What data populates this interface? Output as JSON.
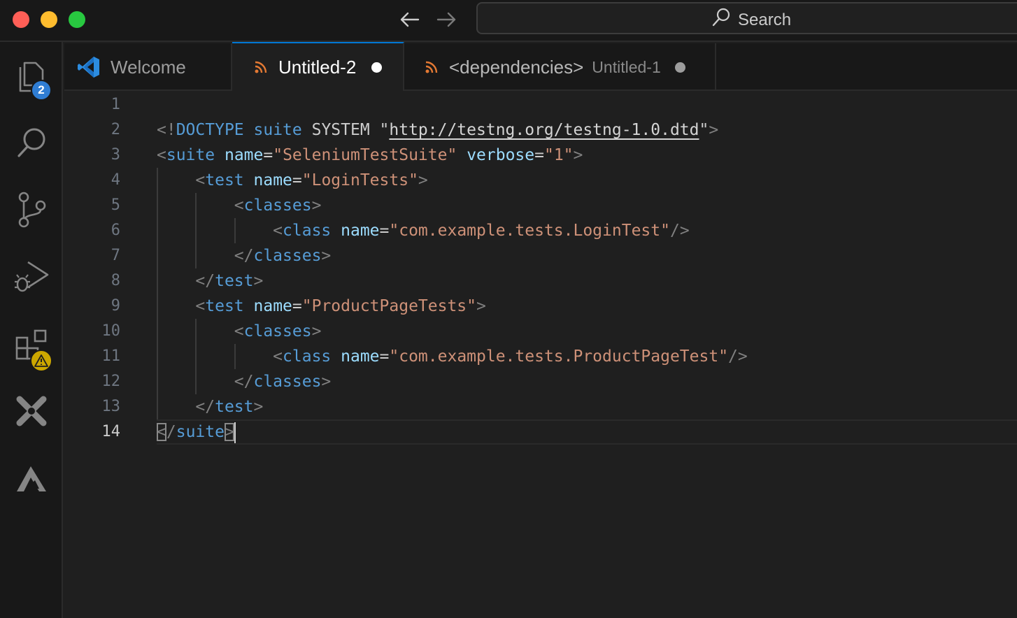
{
  "window": {
    "search_label": "Search"
  },
  "activity_bar": {
    "items": [
      {
        "name": "explorer",
        "icon": "files-icon",
        "badge": "2"
      },
      {
        "name": "search",
        "icon": "search-icon"
      },
      {
        "name": "source-control",
        "icon": "source-control-icon"
      },
      {
        "name": "run-debug",
        "icon": "run-debug-icon"
      },
      {
        "name": "extensions",
        "icon": "extensions-icon",
        "badge": "⚠"
      },
      {
        "name": "extension-x",
        "icon": "x-tool-icon"
      },
      {
        "name": "extension-a",
        "icon": "a-tool-icon"
      }
    ]
  },
  "tabs": [
    {
      "label": "Welcome",
      "icon": "vscode-logo-icon",
      "active": false
    },
    {
      "label": "Untitled-2",
      "icon": "rss-icon",
      "active": true,
      "dirty": true
    },
    {
      "label": "<dependencies>",
      "sublabel": "Untitled-1",
      "icon": "rss-icon",
      "active": false,
      "dirty": true
    }
  ],
  "editor": {
    "current_line": 14,
    "line_numbers": [
      "1",
      "2",
      "3",
      "4",
      "5",
      "6",
      "7",
      "8",
      "9",
      "10",
      "11",
      "12",
      "13",
      "14"
    ],
    "lines": [
      [],
      [
        [
          "br",
          "<!"
        ],
        [
          "tag",
          "DOCTYPE"
        ],
        [
          "plain",
          " "
        ],
        [
          "tag",
          "suite"
        ],
        [
          "plain",
          " SYSTEM \""
        ],
        [
          "link",
          "http://testng.org/testng-1.0.dtd"
        ],
        [
          "plain",
          "\""
        ],
        [
          "br",
          ">"
        ]
      ],
      [
        [
          "br",
          "<"
        ],
        [
          "tag",
          "suite"
        ],
        [
          "plain",
          " "
        ],
        [
          "attr",
          "name"
        ],
        [
          "plain",
          "="
        ],
        [
          "str",
          "\"SeleniumTestSuite\""
        ],
        [
          "plain",
          " "
        ],
        [
          "attr",
          "verbose"
        ],
        [
          "plain",
          "="
        ],
        [
          "str",
          "\"1\""
        ],
        [
          "br",
          ">"
        ]
      ],
      [
        [
          "plain",
          "    "
        ],
        [
          "br",
          "<"
        ],
        [
          "tag",
          "test"
        ],
        [
          "plain",
          " "
        ],
        [
          "attr",
          "name"
        ],
        [
          "plain",
          "="
        ],
        [
          "str",
          "\"LoginTests\""
        ],
        [
          "br",
          ">"
        ]
      ],
      [
        [
          "plain",
          "        "
        ],
        [
          "br",
          "<"
        ],
        [
          "tag",
          "classes"
        ],
        [
          "br",
          ">"
        ]
      ],
      [
        [
          "plain",
          "            "
        ],
        [
          "br",
          "<"
        ],
        [
          "tag",
          "class"
        ],
        [
          "plain",
          " "
        ],
        [
          "attr",
          "name"
        ],
        [
          "plain",
          "="
        ],
        [
          "str",
          "\"com.example.tests.LoginTest\""
        ],
        [
          "br",
          "/>"
        ]
      ],
      [
        [
          "plain",
          "        "
        ],
        [
          "br",
          "</"
        ],
        [
          "tag",
          "classes"
        ],
        [
          "br",
          ">"
        ]
      ],
      [
        [
          "plain",
          "    "
        ],
        [
          "br",
          "</"
        ],
        [
          "tag",
          "test"
        ],
        [
          "br",
          ">"
        ]
      ],
      [
        [
          "plain",
          "    "
        ],
        [
          "br",
          "<"
        ],
        [
          "tag",
          "test"
        ],
        [
          "plain",
          " "
        ],
        [
          "attr",
          "name"
        ],
        [
          "plain",
          "="
        ],
        [
          "str",
          "\"ProductPageTests\""
        ],
        [
          "br",
          ">"
        ]
      ],
      [
        [
          "plain",
          "        "
        ],
        [
          "br",
          "<"
        ],
        [
          "tag",
          "classes"
        ],
        [
          "br",
          ">"
        ]
      ],
      [
        [
          "plain",
          "            "
        ],
        [
          "br",
          "<"
        ],
        [
          "tag",
          "class"
        ],
        [
          "plain",
          " "
        ],
        [
          "attr",
          "name"
        ],
        [
          "plain",
          "="
        ],
        [
          "str",
          "\"com.example.tests.ProductPageTest\""
        ],
        [
          "br",
          "/>"
        ]
      ],
      [
        [
          "plain",
          "        "
        ],
        [
          "br",
          "</"
        ],
        [
          "tag",
          "classes"
        ],
        [
          "br",
          ">"
        ]
      ],
      [
        [
          "plain",
          "    "
        ],
        [
          "br",
          "</"
        ],
        [
          "tag",
          "test"
        ],
        [
          "br",
          ">"
        ]
      ],
      [
        [
          "match",
          "<"
        ],
        [
          "br",
          "/"
        ],
        [
          "tag",
          "suite"
        ],
        [
          "match",
          ">"
        ],
        [
          "caret",
          ""
        ]
      ]
    ]
  },
  "colors": {
    "accent": "#0078d4",
    "tag": "#569cd6",
    "attr": "#9cdcfe",
    "string": "#ce9178",
    "bracket": "#808080",
    "rss": "#e37933"
  }
}
